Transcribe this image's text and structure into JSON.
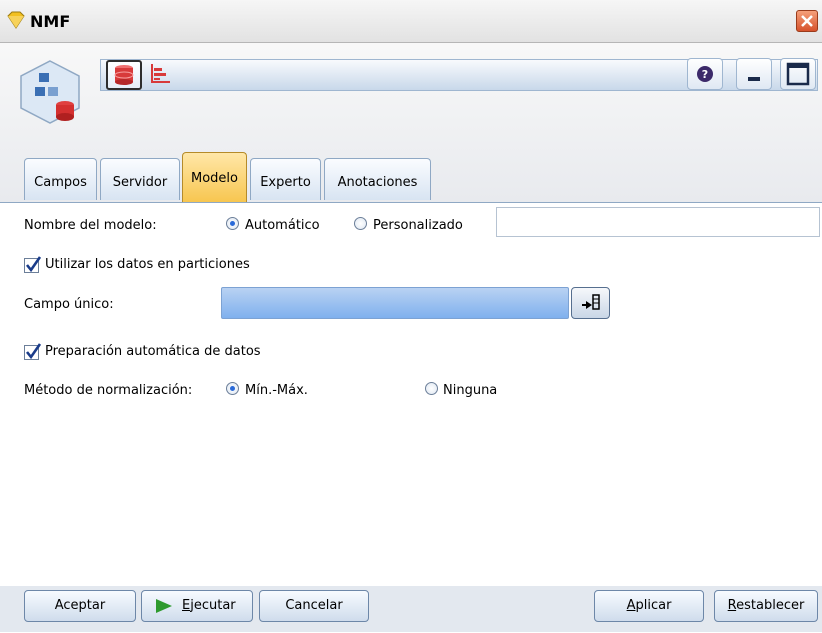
{
  "window": {
    "title": "NMF"
  },
  "tabs": [
    {
      "label": "Campos"
    },
    {
      "label": "Servidor"
    },
    {
      "label": "Modelo"
    },
    {
      "label": "Experto"
    },
    {
      "label": "Anotaciones"
    }
  ],
  "active_tab": "Modelo",
  "form": {
    "model_name_label": "Nombre del modelo:",
    "model_name_auto": "Automático",
    "model_name_custom": "Personalizado",
    "model_name_value": "",
    "model_name_selected": "Automático",
    "use_partitions_label": "Utilizar los datos en particiones",
    "use_partitions_checked": true,
    "unique_field_label": "Campo único:",
    "unique_field_value": "",
    "auto_prep_label": "Preparación automática de datos",
    "auto_prep_checked": true,
    "normalization_label": "Método de normalización:",
    "normalization_minmax": "Mín.-Máx.",
    "normalization_none": "Ninguna",
    "normalization_selected": "Mín.-Máx."
  },
  "buttons": {
    "accept": "Aceptar",
    "run_first": "E",
    "run_rest": "jecutar",
    "cancel": "Cancelar",
    "apply_first": "A",
    "apply_rest": "plicar",
    "reset_first": "R",
    "reset_rest": "establecer"
  },
  "icons": {
    "title": "gem-icon",
    "close": "close-icon",
    "node": "nmf-node-icon",
    "database": "database-icon",
    "chart": "chart-icon",
    "help": "help-icon",
    "minimize": "minimize-icon",
    "maximize": "maximize-icon",
    "field_picker": "field-picker-icon",
    "run": "play-icon"
  },
  "colors": {
    "active_tab": "#f7c650",
    "field_select": "#7fb0ee",
    "run_icon": "#2e9a2e"
  }
}
